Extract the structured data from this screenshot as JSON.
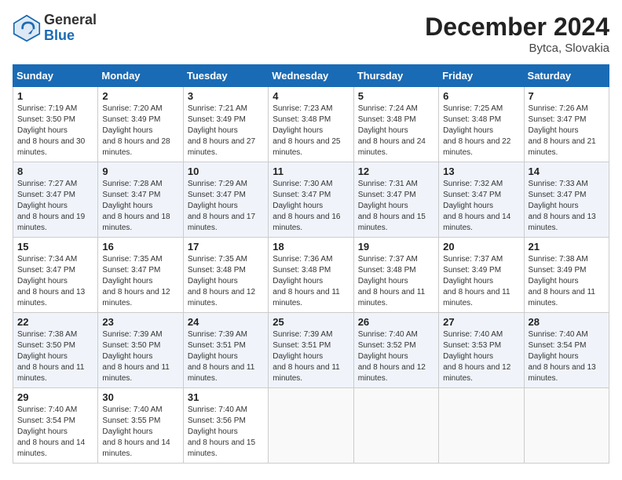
{
  "logo": {
    "general": "General",
    "blue": "Blue"
  },
  "title": "December 2024",
  "location": "Bytca, Slovakia",
  "days_of_week": [
    "Sunday",
    "Monday",
    "Tuesday",
    "Wednesday",
    "Thursday",
    "Friday",
    "Saturday"
  ],
  "weeks": [
    [
      {
        "day": "1",
        "sunrise": "7:19 AM",
        "sunset": "3:50 PM",
        "daylight": "8 hours and 30 minutes."
      },
      {
        "day": "2",
        "sunrise": "7:20 AM",
        "sunset": "3:49 PM",
        "daylight": "8 hours and 28 minutes."
      },
      {
        "day": "3",
        "sunrise": "7:21 AM",
        "sunset": "3:49 PM",
        "daylight": "8 hours and 27 minutes."
      },
      {
        "day": "4",
        "sunrise": "7:23 AM",
        "sunset": "3:48 PM",
        "daylight": "8 hours and 25 minutes."
      },
      {
        "day": "5",
        "sunrise": "7:24 AM",
        "sunset": "3:48 PM",
        "daylight": "8 hours and 24 minutes."
      },
      {
        "day": "6",
        "sunrise": "7:25 AM",
        "sunset": "3:48 PM",
        "daylight": "8 hours and 22 minutes."
      },
      {
        "day": "7",
        "sunrise": "7:26 AM",
        "sunset": "3:47 PM",
        "daylight": "8 hours and 21 minutes."
      }
    ],
    [
      {
        "day": "8",
        "sunrise": "7:27 AM",
        "sunset": "3:47 PM",
        "daylight": "8 hours and 19 minutes."
      },
      {
        "day": "9",
        "sunrise": "7:28 AM",
        "sunset": "3:47 PM",
        "daylight": "8 hours and 18 minutes."
      },
      {
        "day": "10",
        "sunrise": "7:29 AM",
        "sunset": "3:47 PM",
        "daylight": "8 hours and 17 minutes."
      },
      {
        "day": "11",
        "sunrise": "7:30 AM",
        "sunset": "3:47 PM",
        "daylight": "8 hours and 16 minutes."
      },
      {
        "day": "12",
        "sunrise": "7:31 AM",
        "sunset": "3:47 PM",
        "daylight": "8 hours and 15 minutes."
      },
      {
        "day": "13",
        "sunrise": "7:32 AM",
        "sunset": "3:47 PM",
        "daylight": "8 hours and 14 minutes."
      },
      {
        "day": "14",
        "sunrise": "7:33 AM",
        "sunset": "3:47 PM",
        "daylight": "8 hours and 13 minutes."
      }
    ],
    [
      {
        "day": "15",
        "sunrise": "7:34 AM",
        "sunset": "3:47 PM",
        "daylight": "8 hours and 13 minutes."
      },
      {
        "day": "16",
        "sunrise": "7:35 AM",
        "sunset": "3:47 PM",
        "daylight": "8 hours and 12 minutes."
      },
      {
        "day": "17",
        "sunrise": "7:35 AM",
        "sunset": "3:48 PM",
        "daylight": "8 hours and 12 minutes."
      },
      {
        "day": "18",
        "sunrise": "7:36 AM",
        "sunset": "3:48 PM",
        "daylight": "8 hours and 11 minutes."
      },
      {
        "day": "19",
        "sunrise": "7:37 AM",
        "sunset": "3:48 PM",
        "daylight": "8 hours and 11 minutes."
      },
      {
        "day": "20",
        "sunrise": "7:37 AM",
        "sunset": "3:49 PM",
        "daylight": "8 hours and 11 minutes."
      },
      {
        "day": "21",
        "sunrise": "7:38 AM",
        "sunset": "3:49 PM",
        "daylight": "8 hours and 11 minutes."
      }
    ],
    [
      {
        "day": "22",
        "sunrise": "7:38 AM",
        "sunset": "3:50 PM",
        "daylight": "8 hours and 11 minutes."
      },
      {
        "day": "23",
        "sunrise": "7:39 AM",
        "sunset": "3:50 PM",
        "daylight": "8 hours and 11 minutes."
      },
      {
        "day": "24",
        "sunrise": "7:39 AM",
        "sunset": "3:51 PM",
        "daylight": "8 hours and 11 minutes."
      },
      {
        "day": "25",
        "sunrise": "7:39 AM",
        "sunset": "3:51 PM",
        "daylight": "8 hours and 11 minutes."
      },
      {
        "day": "26",
        "sunrise": "7:40 AM",
        "sunset": "3:52 PM",
        "daylight": "8 hours and 12 minutes."
      },
      {
        "day": "27",
        "sunrise": "7:40 AM",
        "sunset": "3:53 PM",
        "daylight": "8 hours and 12 minutes."
      },
      {
        "day": "28",
        "sunrise": "7:40 AM",
        "sunset": "3:54 PM",
        "daylight": "8 hours and 13 minutes."
      }
    ],
    [
      {
        "day": "29",
        "sunrise": "7:40 AM",
        "sunset": "3:54 PM",
        "daylight": "8 hours and 14 minutes."
      },
      {
        "day": "30",
        "sunrise": "7:40 AM",
        "sunset": "3:55 PM",
        "daylight": "8 hours and 14 minutes."
      },
      {
        "day": "31",
        "sunrise": "7:40 AM",
        "sunset": "3:56 PM",
        "daylight": "8 hours and 15 minutes."
      },
      null,
      null,
      null,
      null
    ]
  ]
}
